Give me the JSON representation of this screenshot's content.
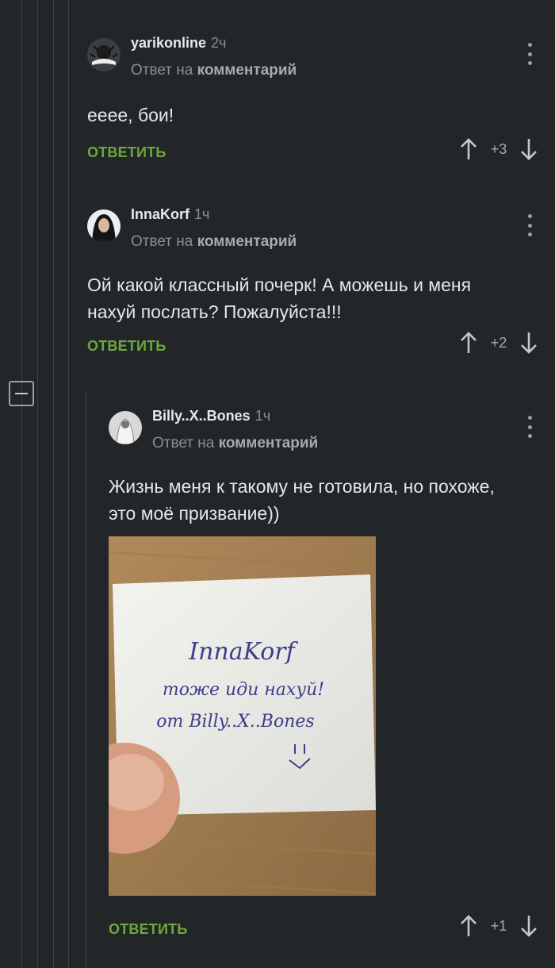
{
  "comments": [
    {
      "username": "yarikonline",
      "time": "2ч",
      "reply_prefix": "Ответ на",
      "reply_target": "комментарий",
      "text": "ееее, бои!",
      "reply_label": "ОТВЕТИТЬ",
      "rating": "+3"
    },
    {
      "username": "InnaKorf",
      "time": "1ч",
      "reply_prefix": "Ответ на",
      "reply_target": "комментарий",
      "text": "Ой какой классный почерк! А можешь и меня нахуй послать? Пожалуйста!!!",
      "reply_label": "ОТВЕТИТЬ",
      "rating": "+2"
    },
    {
      "username": "Billy..X..Bones",
      "time": "1ч",
      "reply_prefix": "Ответ на",
      "reply_target": "комментарий",
      "text": "Жизнь меня к такому не готовила, но похоже, это моё призвание))",
      "reply_label": "ОТВЕТИТЬ",
      "rating": "+1",
      "photo": {
        "note_line1": "InnaKorf",
        "note_line2": "тоже иди нахуй!",
        "note_line3": "от Billy..X..Bones"
      }
    }
  ],
  "icons": {
    "upvote": "arrow-up-icon",
    "downvote": "arrow-down-icon",
    "menu": "more-vertical-icon",
    "collapse": "minus-square-icon"
  },
  "colors": {
    "background": "#232629",
    "reply_button": "#6da83a",
    "muted": "#8a8f94"
  }
}
